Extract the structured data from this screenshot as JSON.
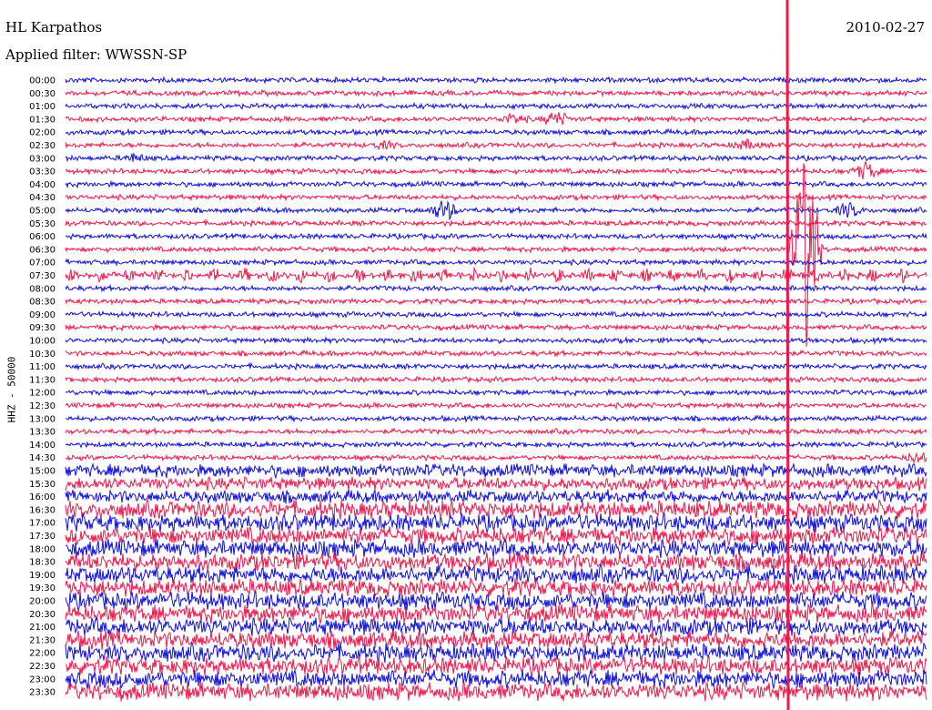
{
  "header": {
    "station": "HL Karpathos",
    "date": "2010-02-27",
    "filter": "Applied filter: WWSSN-SP",
    "channel": "HHZ - 50000"
  },
  "colors": {
    "trace_a": "#1010e0",
    "trace_b": "#f0184a"
  },
  "chart_data": {
    "type": "line",
    "title": "",
    "xlabel": "",
    "ylabel": "HHZ - 50000",
    "rows": [
      "00:00",
      "00:30",
      "01:00",
      "01:30",
      "02:00",
      "02:30",
      "03:00",
      "03:30",
      "04:00",
      "04:30",
      "05:00",
      "05:30",
      "06:00",
      "06:30",
      "07:00",
      "07:30",
      "08:00",
      "08:30",
      "09:00",
      "09:30",
      "10:00",
      "10:30",
      "11:00",
      "11:30",
      "12:00",
      "12:30",
      "13:00",
      "13:30",
      "14:00",
      "14:30",
      "15:00",
      "15:30",
      "16:00",
      "16:30",
      "17:00",
      "17:30",
      "18:00",
      "18:30",
      "19:00",
      "19:30",
      "20:00",
      "20:30",
      "21:00",
      "21:30",
      "22:00",
      "22:30",
      "23:00",
      "23:30"
    ],
    "row_colors": [
      "#1010e0",
      "#f0184a"
    ],
    "events": [
      {
        "row": "01:30",
        "x": 0.52,
        "amp": 0.8
      },
      {
        "row": "01:30",
        "x": 0.57,
        "amp": 1.2
      },
      {
        "row": "02:30",
        "x": 0.37,
        "amp": 0.5
      },
      {
        "row": "02:30",
        "x": 0.79,
        "amp": 0.7
      },
      {
        "row": "03:00",
        "x": 0.08,
        "amp": 0.6
      },
      {
        "row": "05:00",
        "x": 0.44,
        "amp": 1.8
      },
      {
        "row": "06:30",
        "x": 0.86,
        "amp": 20
      },
      {
        "row": "03:30",
        "x": 0.93,
        "amp": 1.5
      },
      {
        "row": "05:00",
        "x": 0.91,
        "amp": 1.2
      },
      {
        "row": "14:30",
        "x": 0.99,
        "amp": 0.9
      }
    ]
  }
}
